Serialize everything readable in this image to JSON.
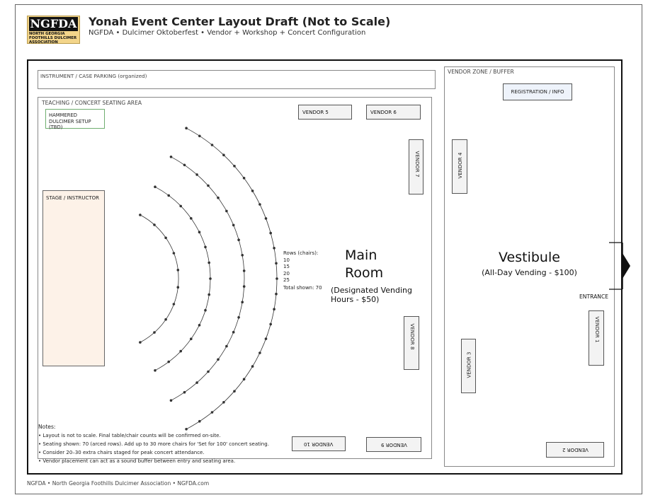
{
  "header": {
    "logo_text": "NGFDA",
    "logo_subtext": "NORTH GEORGIA FOOTHILLS DULCIMER ASSOCIATION",
    "title": "Yonah Event Center Layout Draft (Not to Scale)",
    "subtitle": "NGFDA • Dulcimer Oktoberfest • Vendor + Workshop + Concert Configuration"
  },
  "zones": {
    "instrument_parking": "INSTRUMENT / CASE PARKING (organized)",
    "teaching_area": "TEACHING / CONCERT SEATING AREA",
    "vendor_zone": "VENDOR ZONE / BUFFER",
    "hammered_dulcimer": "HAMMERED DULCIMER SETUP (TBD)",
    "stage": "STAGE / INSTRUCTOR",
    "registration": "REGISTRATION / INFO",
    "entrance": "ENTRANCE"
  },
  "vendors": {
    "v1": "VENDOR 1",
    "v2": "VENDOR 2",
    "v3": "VENDOR 3",
    "v4": "VENDOR 4",
    "v5": "VENDOR 5",
    "v6": "VENDOR 6",
    "v7": "VENDOR 7",
    "v8": "VENDOR 8",
    "v9": "VENDOR 9",
    "v10": "VENDOR 10"
  },
  "main_room": {
    "title_line1": "Main",
    "title_line2": "Room",
    "note_line1": "(Designated Vending",
    "note_line2": "Hours - $50)"
  },
  "vestibule": {
    "title": "Vestibule",
    "note": "(All-Day Vending - $100)"
  },
  "seating": {
    "rows_label": "Rows (chairs):",
    "rows": [
      10,
      15,
      20,
      25
    ],
    "total_label": "Total shown: 70"
  },
  "notes": {
    "heading": "Notes:",
    "items": [
      "• Layout is not to scale. Final table/chair counts will be confirmed on-site.",
      "• Seating shown: 70 (arced rows). Add up to 30 more chairs for 'Set for 100' concert seating.",
      "• Consider 20–30 extra chairs staged for peak concert attendance.",
      "• Vendor placement can act as a sound buffer between entry and seating area."
    ]
  },
  "footer": "NGFDA • North Georgia Foothills Dulcimer Association • NGFDA.com"
}
